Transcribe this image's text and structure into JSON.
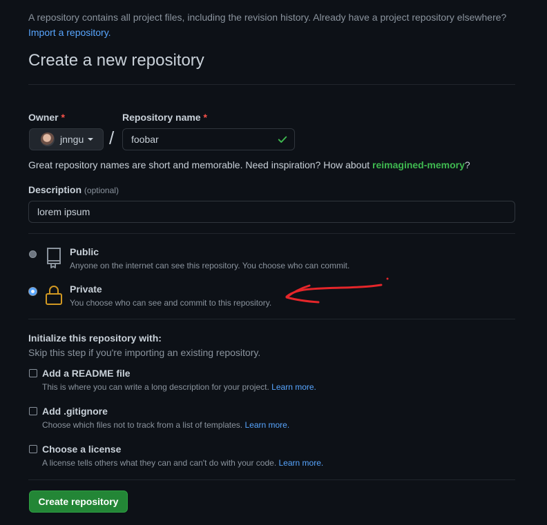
{
  "intro": {
    "text": "A repository contains all project files, including the revision history. Already have a project repository elsewhere?",
    "import_link": "Import a repository."
  },
  "page_title": "Create a new repository",
  "owner": {
    "label": "Owner",
    "required_mark": "*",
    "value": "jnngu"
  },
  "separator": "/",
  "repo_name": {
    "label": "Repository name",
    "required_mark": "*",
    "value": "foobar",
    "valid": true
  },
  "hint": {
    "text": "Great repository names are short and memorable. Need inspiration? How about",
    "suggestion": "reimagined-memory",
    "end": "?"
  },
  "description": {
    "label": "Description",
    "optional": "(optional)",
    "value": "lorem ipsum"
  },
  "visibility": [
    {
      "title": "Public",
      "desc": "Anyone on the internet can see this repository. You choose who can commit.",
      "selected": false,
      "icon": "repo-icon"
    },
    {
      "title": "Private",
      "desc": "You choose who can see and commit to this repository.",
      "selected": true,
      "icon": "lock-icon"
    }
  ],
  "init": {
    "title": "Initialize this repository with:",
    "subtitle": "Skip this step if you're importing an existing repository.",
    "options": [
      {
        "title": "Add a README file",
        "desc": "This is where you can write a long description for your project.",
        "link": "Learn more.",
        "checked": false
      },
      {
        "title": "Add .gitignore",
        "desc": "Choose which files not to track from a list of templates.",
        "link": "Learn more.",
        "checked": false
      },
      {
        "title": "Choose a license",
        "desc": "A license tells others what they can and can't do with your code.",
        "link": "Learn more.",
        "checked": false
      }
    ]
  },
  "create_button": "Create repository",
  "colors": {
    "background": "#0d1117",
    "link": "#58a6ff",
    "success": "#3fb950",
    "button": "#238636",
    "annotation": "#e5262a"
  }
}
